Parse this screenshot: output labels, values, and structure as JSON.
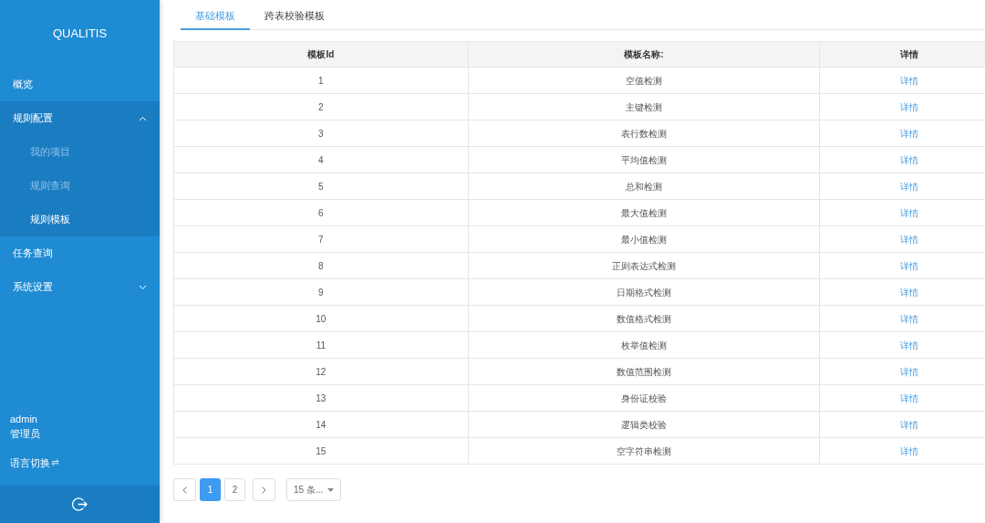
{
  "sidebar": {
    "logo": "QUALITIS",
    "menu": [
      {
        "label": "概览",
        "selected": false
      },
      {
        "label": "规则配置",
        "selected": false,
        "expanded": true,
        "children": [
          {
            "label": "我的项目",
            "selected": false
          },
          {
            "label": "规则查询",
            "selected": false
          },
          {
            "label": "规则模板",
            "selected": true
          }
        ]
      },
      {
        "label": "任务查询",
        "selected": false
      },
      {
        "label": "系统设置",
        "selected": false,
        "expanded": false
      }
    ],
    "user": {
      "name": "admin",
      "role": "管理员"
    },
    "language_switch": "语言切换"
  },
  "tabs": [
    {
      "label": "基础模板",
      "selected": true
    },
    {
      "label": "跨表校验模板",
      "selected": false
    }
  ],
  "table": {
    "columns": [
      "模板Id",
      "模板名称:",
      "详情"
    ],
    "rows": [
      [
        "1",
        "空值检测",
        "详情"
      ],
      [
        "2",
        "主键检测",
        "详情"
      ],
      [
        "3",
        "表行数检测",
        "详情"
      ],
      [
        "4",
        "平均值检测",
        "详情"
      ],
      [
        "5",
        "总和检测",
        "详情"
      ],
      [
        "6",
        "最大值检测",
        "详情"
      ],
      [
        "7",
        "最小值检测",
        "详情"
      ],
      [
        "8",
        "正则表达式检测",
        "详情"
      ],
      [
        "9",
        "日期格式检测",
        "详情"
      ],
      [
        "10",
        "数值格式检测",
        "详情"
      ],
      [
        "11",
        "枚举值检测",
        "详情"
      ],
      [
        "12",
        "数值范围检测",
        "详情"
      ],
      [
        "13",
        "身份证校验",
        "详情"
      ],
      [
        "14",
        "逻辑类校验",
        "详情"
      ],
      [
        "15",
        "空字符串检测",
        "详情"
      ]
    ]
  },
  "pagination": {
    "pages": [
      {
        "label": "1",
        "selected": true
      },
      {
        "label": "2",
        "selected": false
      }
    ],
    "page_size": "15 条..."
  }
}
